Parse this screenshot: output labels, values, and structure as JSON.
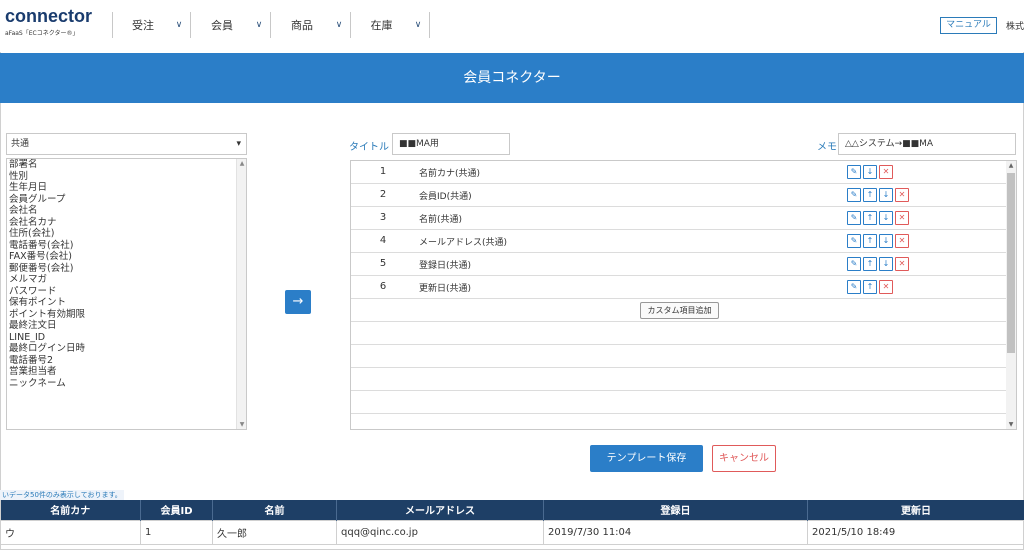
{
  "header": {
    "logo": "connector",
    "logo_sub": "aFaaS「ECコネクター®」",
    "nav": [
      {
        "label": "受注"
      },
      {
        "label": "会員"
      },
      {
        "label": "商品"
      },
      {
        "label": "在庫"
      }
    ],
    "manual_label": "マニュアル",
    "corp_label": "株式"
  },
  "banner": {
    "title": "会員コネクター"
  },
  "left": {
    "category_selected": "共通",
    "fields": [
      "部署名",
      "性別",
      "生年月日",
      "会員グループ",
      "会社名",
      "会社名カナ",
      "住所(会社)",
      "電話番号(会社)",
      "FAX番号(会社)",
      "郵便番号(会社)",
      "メルマガ",
      "パスワード",
      "保有ポイント",
      "ポイント有効期限",
      "最終注文日",
      "LINE_ID",
      "最終ログイン日時",
      "電話番号2",
      "営業担当者",
      "ニックネーム"
    ]
  },
  "form": {
    "title_label": "タイトル",
    "title_value": "■■MA用",
    "memo_label": "メモ",
    "memo_value": "△△システム→■■MA"
  },
  "selected": [
    {
      "num": "1",
      "name": "名前カナ(共通)"
    },
    {
      "num": "2",
      "name": "会員ID(共通)"
    },
    {
      "num": "3",
      "name": "名前(共通)"
    },
    {
      "num": "4",
      "name": "メールアドレス(共通)"
    },
    {
      "num": "5",
      "name": "登録日(共通)"
    },
    {
      "num": "6",
      "name": "更新日(共通)"
    }
  ],
  "custom_add_label": "カスタム項目追加",
  "actions": {
    "save": "テンプレート保存",
    "cancel": "キャンセル"
  },
  "notice": "いデータ50件のみ表示しております。",
  "preview": {
    "headers": [
      "名前カナ",
      "会員ID",
      "名前",
      "メールアドレス",
      "登録日",
      "更新日"
    ],
    "rows": [
      [
        "ウ",
        "1",
        "久一郎",
        "qqq@qinc.co.jp",
        "2019/7/30 11:04",
        "2021/5/10 18:49"
      ]
    ]
  },
  "icons": {
    "edit": "pencil-icon",
    "up": "arrow-up-icon",
    "down": "arrow-down-icon",
    "delete": "close-icon",
    "add": "arrow-right-icon"
  },
  "colors": {
    "accent": "#2b7ec8",
    "header_dark": "#1e3f66",
    "danger": "#e05a5a"
  }
}
